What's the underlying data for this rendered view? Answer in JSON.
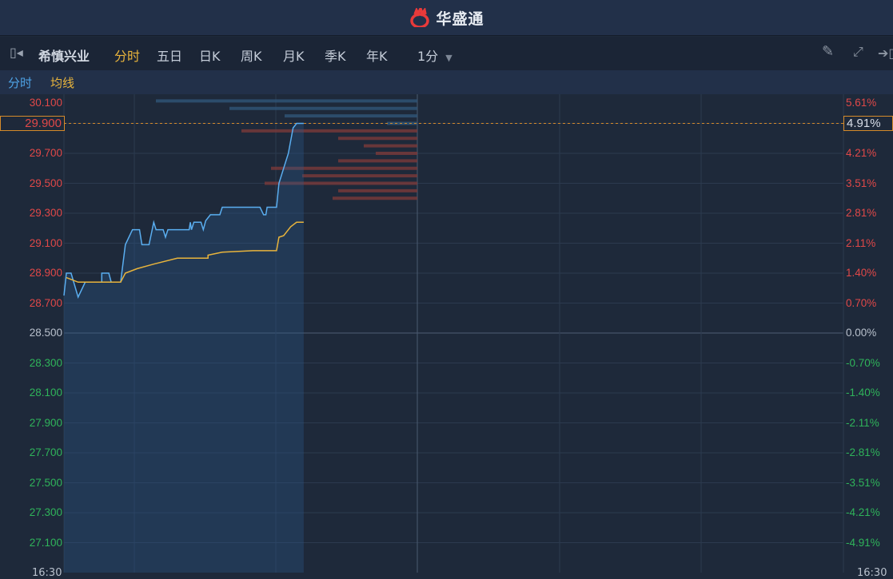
{
  "header": {
    "brand": "华盛通",
    "logo_icon": "huasheng-flame-logo"
  },
  "toolbar": {
    "stock_name": "希慎兴业",
    "tabs": [
      "分时",
      "五日",
      "日K",
      "周K",
      "月K",
      "季K",
      "年K"
    ],
    "active_tab": "分时",
    "interval": "1分"
  },
  "legend": {
    "price_label": "分时",
    "avg_label": "均线"
  },
  "colors": {
    "up": "#e04848",
    "down": "#2fb35a",
    "price_line": "#5aaef0",
    "avg_line": "#e8b43c",
    "accent": "#d58a2a"
  },
  "current": {
    "price": "29.900",
    "change": "4.91%"
  },
  "time_labels": [
    "16:30",
    "16:30"
  ],
  "chart_data": {
    "type": "line",
    "prev_close": 28.5,
    "ylim": [
      27.0,
      30.15
    ],
    "xlim": [
      0,
      330
    ],
    "left_ticks": [
      "30.100",
      "29.900",
      "29.700",
      "29.500",
      "29.300",
      "29.100",
      "28.900",
      "28.700",
      "28.500",
      "28.300",
      "28.100",
      "27.900",
      "27.700",
      "27.500",
      "27.300",
      "27.100"
    ],
    "right_ticks": [
      "5.61%",
      "4.91%",
      "4.21%",
      "3.51%",
      "2.81%",
      "2.11%",
      "1.40%",
      "0.70%",
      "0.00%",
      "-0.70%",
      "-1.40%",
      "-2.11%",
      "-2.81%",
      "-3.51%",
      "-4.21%",
      "-4.91%"
    ],
    "series": [
      {
        "name": "分时",
        "points": [
          [
            0,
            28.75
          ],
          [
            1,
            28.9
          ],
          [
            3,
            28.9
          ],
          [
            6,
            28.74
          ],
          [
            9,
            28.84
          ],
          [
            16,
            28.84
          ],
          [
            16,
            28.9
          ],
          [
            19,
            28.9
          ],
          [
            20,
            28.84
          ],
          [
            24,
            28.84
          ],
          [
            26,
            29.09
          ],
          [
            29,
            29.19
          ],
          [
            32,
            29.19
          ],
          [
            33,
            29.09
          ],
          [
            36,
            29.09
          ],
          [
            38,
            29.24
          ],
          [
            39,
            29.19
          ],
          [
            42,
            29.19
          ],
          [
            43,
            29.14
          ],
          [
            44,
            29.19
          ],
          [
            53,
            29.19
          ],
          [
            53.5,
            29.24
          ],
          [
            54,
            29.19
          ],
          [
            55,
            29.24
          ],
          [
            58,
            29.24
          ],
          [
            59,
            29.19
          ],
          [
            60,
            29.25
          ],
          [
            62,
            29.29
          ],
          [
            66,
            29.29
          ],
          [
            67,
            29.34
          ],
          [
            83,
            29.34
          ],
          [
            84.5,
            29.29
          ],
          [
            85.5,
            29.29
          ],
          [
            86,
            29.34
          ],
          [
            90,
            29.34
          ],
          [
            91,
            29.5
          ],
          [
            93,
            29.6
          ],
          [
            95,
            29.7
          ],
          [
            97,
            29.87
          ],
          [
            98.5,
            29.9
          ],
          [
            101.5,
            29.9
          ]
        ]
      },
      {
        "name": "均线",
        "points": [
          [
            1,
            28.87
          ],
          [
            6,
            28.84
          ],
          [
            9,
            28.84
          ],
          [
            24,
            28.84
          ],
          [
            26,
            28.9
          ],
          [
            31,
            28.93
          ],
          [
            38,
            28.96
          ],
          [
            48,
            29.0
          ],
          [
            61,
            29.0
          ],
          [
            61,
            29.02
          ],
          [
            67,
            29.04
          ],
          [
            80,
            29.05
          ],
          [
            90,
            29.05
          ],
          [
            91,
            29.14
          ],
          [
            93,
            29.15
          ],
          [
            96,
            29.21
          ],
          [
            98.5,
            29.24
          ],
          [
            101.5,
            29.24
          ]
        ]
      }
    ],
    "order_book": {
      "ask": [
        [
          30.05,
          327
        ],
        [
          30.0,
          235
        ],
        [
          29.95,
          166
        ],
        [
          29.9,
          38
        ]
      ],
      "bid": [
        [
          29.85,
          220
        ],
        [
          29.8,
          99
        ],
        [
          29.75,
          67
        ],
        [
          29.7,
          52
        ],
        [
          29.65,
          99
        ],
        [
          29.6,
          183
        ],
        [
          29.55,
          144
        ],
        [
          29.5,
          191
        ],
        [
          29.45,
          99
        ],
        [
          29.4,
          106
        ]
      ]
    }
  }
}
